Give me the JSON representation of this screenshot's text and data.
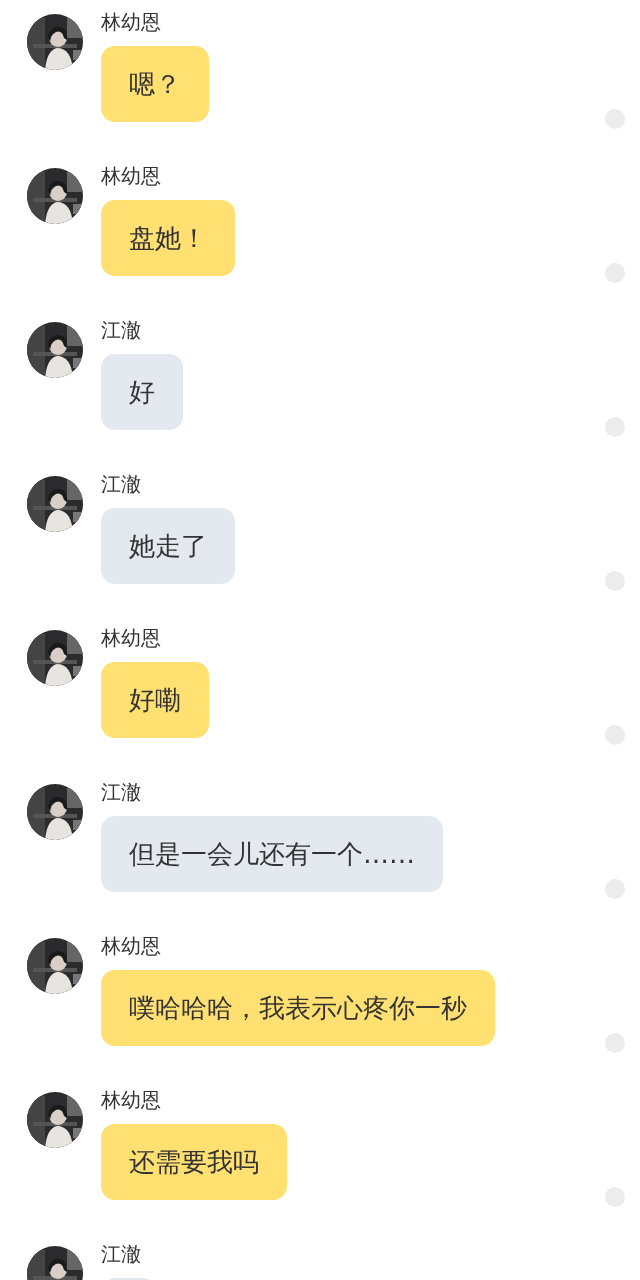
{
  "messages": [
    {
      "sender": "林幼恩",
      "kind": "sent",
      "text": "嗯？",
      "selected": false
    },
    {
      "sender": "林幼恩",
      "kind": "sent",
      "text": "盘她！",
      "selected": false
    },
    {
      "sender": "江澈",
      "kind": "received",
      "text": "好",
      "selected": false
    },
    {
      "sender": "江澈",
      "kind": "received",
      "text": "她走了",
      "selected": false
    },
    {
      "sender": "林幼恩",
      "kind": "sent",
      "text": "好嘞",
      "selected": false
    },
    {
      "sender": "江澈",
      "kind": "received",
      "text": "但是一会儿还有一个……",
      "selected": false
    },
    {
      "sender": "林幼恩",
      "kind": "sent",
      "text": "噗哈哈哈，我表示心疼你一秒",
      "selected": false
    },
    {
      "sender": "林幼恩",
      "kind": "sent",
      "text": "还需要我吗",
      "selected": false
    },
    {
      "sender": "江澈",
      "kind": "received"
    }
  ]
}
